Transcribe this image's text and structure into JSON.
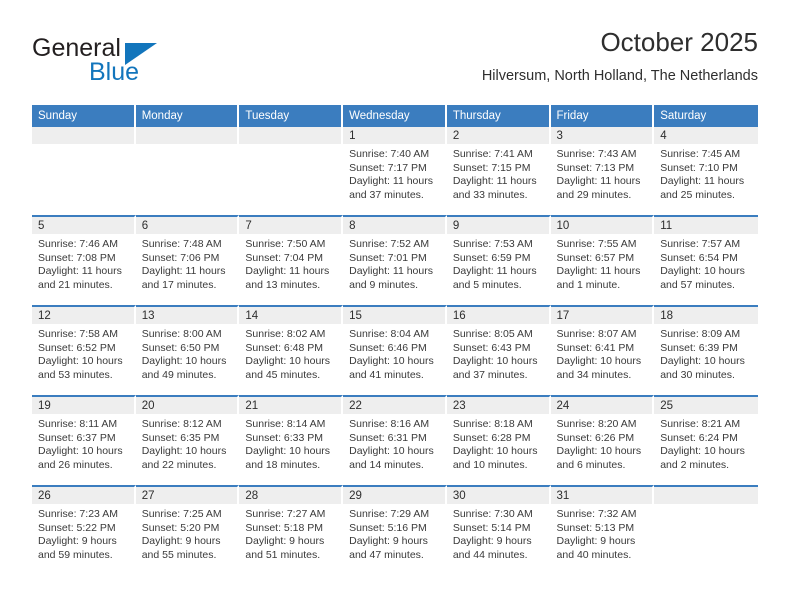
{
  "brand": {
    "name_top": "General",
    "name_bottom": "Blue",
    "color_black": "#231f20",
    "color_blue": "#1275bc"
  },
  "header": {
    "title": "October 2025",
    "subtitle": "Hilversum, North Holland, The Netherlands"
  },
  "theme": {
    "header_blue": "#3b7dbf",
    "daynum_band": "#eeeeee",
    "text": "#3a3a3a"
  },
  "weekdays": [
    "Sunday",
    "Monday",
    "Tuesday",
    "Wednesday",
    "Thursday",
    "Friday",
    "Saturday"
  ],
  "weeks": [
    [
      {
        "day": "",
        "empty": true
      },
      {
        "day": "",
        "empty": true
      },
      {
        "day": "",
        "empty": true
      },
      {
        "day": "1",
        "sunrise": "Sunrise: 7:40 AM",
        "sunset": "Sunset: 7:17 PM",
        "daylight": "Daylight: 11 hours and 37 minutes."
      },
      {
        "day": "2",
        "sunrise": "Sunrise: 7:41 AM",
        "sunset": "Sunset: 7:15 PM",
        "daylight": "Daylight: 11 hours and 33 minutes."
      },
      {
        "day": "3",
        "sunrise": "Sunrise: 7:43 AM",
        "sunset": "Sunset: 7:13 PM",
        "daylight": "Daylight: 11 hours and 29 minutes."
      },
      {
        "day": "4",
        "sunrise": "Sunrise: 7:45 AM",
        "sunset": "Sunset: 7:10 PM",
        "daylight": "Daylight: 11 hours and 25 minutes."
      }
    ],
    [
      {
        "day": "5",
        "sunrise": "Sunrise: 7:46 AM",
        "sunset": "Sunset: 7:08 PM",
        "daylight": "Daylight: 11 hours and 21 minutes."
      },
      {
        "day": "6",
        "sunrise": "Sunrise: 7:48 AM",
        "sunset": "Sunset: 7:06 PM",
        "daylight": "Daylight: 11 hours and 17 minutes."
      },
      {
        "day": "7",
        "sunrise": "Sunrise: 7:50 AM",
        "sunset": "Sunset: 7:04 PM",
        "daylight": "Daylight: 11 hours and 13 minutes."
      },
      {
        "day": "8",
        "sunrise": "Sunrise: 7:52 AM",
        "sunset": "Sunset: 7:01 PM",
        "daylight": "Daylight: 11 hours and 9 minutes."
      },
      {
        "day": "9",
        "sunrise": "Sunrise: 7:53 AM",
        "sunset": "Sunset: 6:59 PM",
        "daylight": "Daylight: 11 hours and 5 minutes."
      },
      {
        "day": "10",
        "sunrise": "Sunrise: 7:55 AM",
        "sunset": "Sunset: 6:57 PM",
        "daylight": "Daylight: 11 hours and 1 minute."
      },
      {
        "day": "11",
        "sunrise": "Sunrise: 7:57 AM",
        "sunset": "Sunset: 6:54 PM",
        "daylight": "Daylight: 10 hours and 57 minutes."
      }
    ],
    [
      {
        "day": "12",
        "sunrise": "Sunrise: 7:58 AM",
        "sunset": "Sunset: 6:52 PM",
        "daylight": "Daylight: 10 hours and 53 minutes."
      },
      {
        "day": "13",
        "sunrise": "Sunrise: 8:00 AM",
        "sunset": "Sunset: 6:50 PM",
        "daylight": "Daylight: 10 hours and 49 minutes."
      },
      {
        "day": "14",
        "sunrise": "Sunrise: 8:02 AM",
        "sunset": "Sunset: 6:48 PM",
        "daylight": "Daylight: 10 hours and 45 minutes."
      },
      {
        "day": "15",
        "sunrise": "Sunrise: 8:04 AM",
        "sunset": "Sunset: 6:46 PM",
        "daylight": "Daylight: 10 hours and 41 minutes."
      },
      {
        "day": "16",
        "sunrise": "Sunrise: 8:05 AM",
        "sunset": "Sunset: 6:43 PM",
        "daylight": "Daylight: 10 hours and 37 minutes."
      },
      {
        "day": "17",
        "sunrise": "Sunrise: 8:07 AM",
        "sunset": "Sunset: 6:41 PM",
        "daylight": "Daylight: 10 hours and 34 minutes."
      },
      {
        "day": "18",
        "sunrise": "Sunrise: 8:09 AM",
        "sunset": "Sunset: 6:39 PM",
        "daylight": "Daylight: 10 hours and 30 minutes."
      }
    ],
    [
      {
        "day": "19",
        "sunrise": "Sunrise: 8:11 AM",
        "sunset": "Sunset: 6:37 PM",
        "daylight": "Daylight: 10 hours and 26 minutes."
      },
      {
        "day": "20",
        "sunrise": "Sunrise: 8:12 AM",
        "sunset": "Sunset: 6:35 PM",
        "daylight": "Daylight: 10 hours and 22 minutes."
      },
      {
        "day": "21",
        "sunrise": "Sunrise: 8:14 AM",
        "sunset": "Sunset: 6:33 PM",
        "daylight": "Daylight: 10 hours and 18 minutes."
      },
      {
        "day": "22",
        "sunrise": "Sunrise: 8:16 AM",
        "sunset": "Sunset: 6:31 PM",
        "daylight": "Daylight: 10 hours and 14 minutes."
      },
      {
        "day": "23",
        "sunrise": "Sunrise: 8:18 AM",
        "sunset": "Sunset: 6:28 PM",
        "daylight": "Daylight: 10 hours and 10 minutes."
      },
      {
        "day": "24",
        "sunrise": "Sunrise: 8:20 AM",
        "sunset": "Sunset: 6:26 PM",
        "daylight": "Daylight: 10 hours and 6 minutes."
      },
      {
        "day": "25",
        "sunrise": "Sunrise: 8:21 AM",
        "sunset": "Sunset: 6:24 PM",
        "daylight": "Daylight: 10 hours and 2 minutes."
      }
    ],
    [
      {
        "day": "26",
        "sunrise": "Sunrise: 7:23 AM",
        "sunset": "Sunset: 5:22 PM",
        "daylight": "Daylight: 9 hours and 59 minutes."
      },
      {
        "day": "27",
        "sunrise": "Sunrise: 7:25 AM",
        "sunset": "Sunset: 5:20 PM",
        "daylight": "Daylight: 9 hours and 55 minutes."
      },
      {
        "day": "28",
        "sunrise": "Sunrise: 7:27 AM",
        "sunset": "Sunset: 5:18 PM",
        "daylight": "Daylight: 9 hours and 51 minutes."
      },
      {
        "day": "29",
        "sunrise": "Sunrise: 7:29 AM",
        "sunset": "Sunset: 5:16 PM",
        "daylight": "Daylight: 9 hours and 47 minutes."
      },
      {
        "day": "30",
        "sunrise": "Sunrise: 7:30 AM",
        "sunset": "Sunset: 5:14 PM",
        "daylight": "Daylight: 9 hours and 44 minutes."
      },
      {
        "day": "31",
        "sunrise": "Sunrise: 7:32 AM",
        "sunset": "Sunset: 5:13 PM",
        "daylight": "Daylight: 9 hours and 40 minutes."
      },
      {
        "day": "",
        "empty": true
      }
    ]
  ]
}
